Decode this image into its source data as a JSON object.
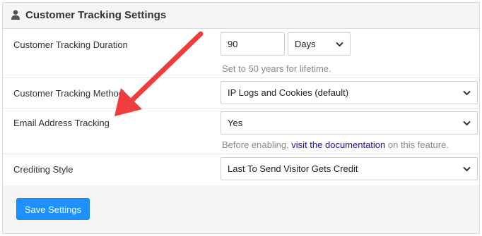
{
  "panel": {
    "title": "Customer Tracking Settings",
    "icon": "user-icon"
  },
  "rows": {
    "duration": {
      "label": "Customer Tracking Duration",
      "value": "90",
      "unit": "Days",
      "help": "Set to 50 years for lifetime."
    },
    "method": {
      "label": "Customer Tracking Method",
      "selected": "IP Logs and Cookies (default)"
    },
    "email": {
      "label": "Email Address Tracking",
      "selected": "Yes",
      "help_before": "Before enabling, ",
      "help_link": "visit the documentation",
      "help_after": " on this feature."
    },
    "crediting": {
      "label": "Crediting Style",
      "selected": "Last To Send Visitor Gets Credit"
    }
  },
  "footer": {
    "save_label": "Save Settings"
  },
  "colors": {
    "annotation_arrow": "#f03c3c",
    "save_button": "#1e90ff",
    "link": "#1a0dab"
  }
}
